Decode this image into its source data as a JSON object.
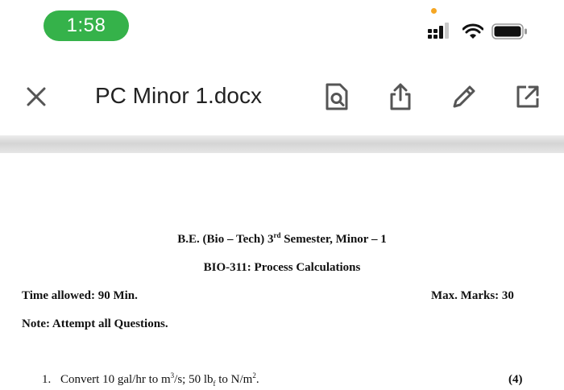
{
  "status_bar": {
    "time": "1:58",
    "icons": [
      "cellular-signal-icon",
      "wifi-icon",
      "battery-icon"
    ],
    "accent": "#35b24a"
  },
  "toolbar": {
    "title": "PC Minor 1.docx",
    "close_icon": "close-icon",
    "actions": [
      "find-in-document-icon",
      "share-icon",
      "edit-icon",
      "open-external-icon"
    ]
  },
  "document": {
    "header_line1_pre": "B.E. (Bio – Tech) 3",
    "header_line1_sup": "rd",
    "header_line1_post": " Semester, Minor – 1",
    "header_line2": "BIO-311: Process Calculations",
    "time_allowed": "Time allowed: 90 Min.",
    "max_marks": "Max. Marks: 30",
    "note": "Note: Attempt all Questions.",
    "questions": [
      {
        "number": "1.",
        "text_a": "Convert 10 gal/hr to m",
        "sup_a": "3",
        "text_b": "/s; 50 lb",
        "sub_b": "f",
        "text_c": " to N/m",
        "sup_c": "2",
        "text_d": ".",
        "marks": "(4)"
      }
    ]
  }
}
